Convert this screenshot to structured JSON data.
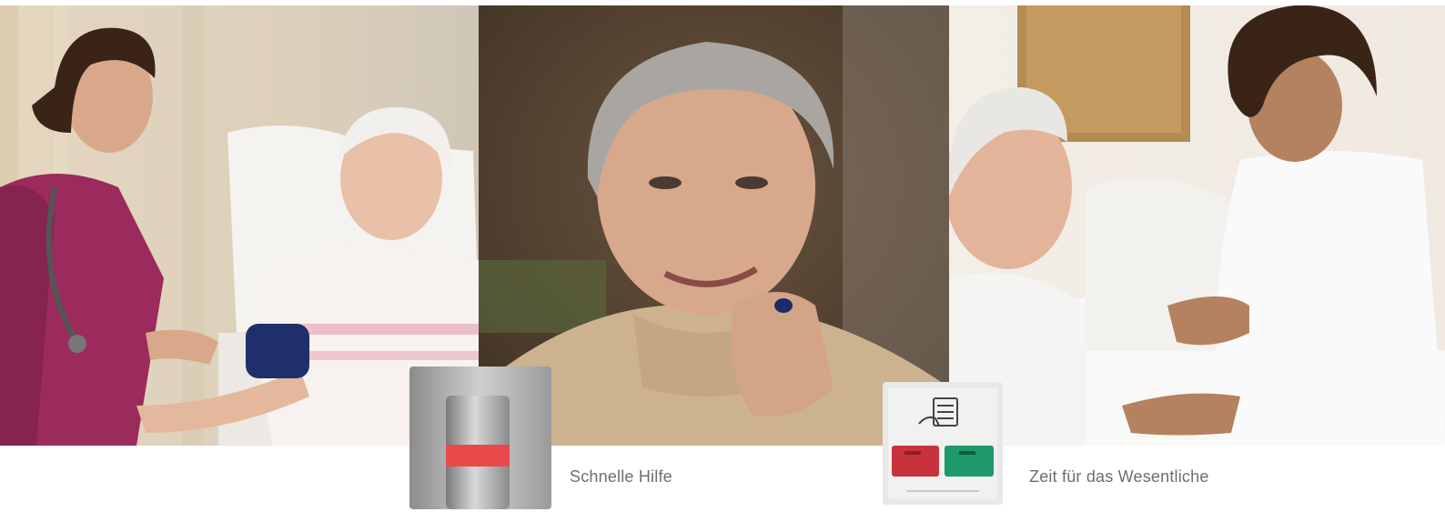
{
  "captions": {
    "quick_help": "Schnelle Hilfe",
    "time_essential": "Zeit für das Wesentliche"
  },
  "photos": [
    {
      "name": "nurse-taking-blood-pressure-photo"
    },
    {
      "name": "smiling-elderly-woman-portrait-photo"
    },
    {
      "name": "nurse-caring-for-elderly-man-photo"
    }
  ],
  "devices": [
    {
      "name": "emergency-pull-switch-device",
      "indicator_color": "#e84a4a"
    },
    {
      "name": "nurse-call-panel-device",
      "button_colors": [
        "#c8323c",
        "#1f9a6a"
      ]
    }
  ]
}
